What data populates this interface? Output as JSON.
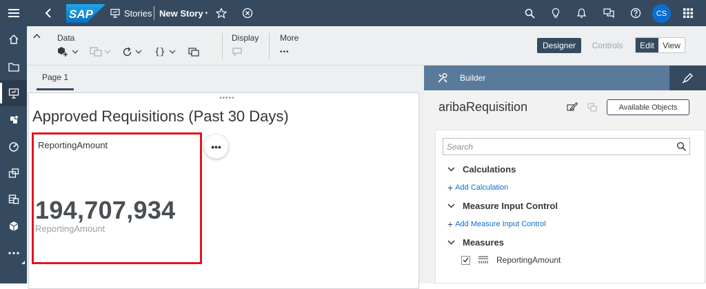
{
  "shell": {
    "logo": "SAP",
    "crumb_stories": "Stories",
    "crumb_story": "New Story",
    "dirty_marker": "•",
    "avatar_initials": "CS"
  },
  "toolbar": {
    "data_label": "Data",
    "display_label": "Display",
    "more_label": "More",
    "more_dots": "•••",
    "designer_label": "Designer",
    "controls_label": "Controls",
    "edit_label": "Edit",
    "view_label": "View"
  },
  "page_tabs": [
    {
      "label": "Page 1"
    }
  ],
  "story": {
    "title": "Approved Requisitions (Past 30 Days)",
    "grip": "•••••",
    "tile": {
      "label": "ReportingAmount",
      "value": "194,707,934",
      "sublabel": "ReportingAmount",
      "more_dots": "•••"
    }
  },
  "builder": {
    "title": "Builder",
    "model_name": "aribaRequisition",
    "available_objects_label": "Available Objects",
    "search_placeholder": "Search",
    "sections": [
      {
        "title": "Calculations",
        "add_label": "Add Calculation"
      },
      {
        "title": "Measure Input Control",
        "add_label": "Add Measure Input Control"
      },
      {
        "title": "Measures"
      }
    ],
    "measure_item": {
      "label": "ReportingAmount",
      "checked": true
    },
    "plus": "+"
  },
  "icons": {
    "menu": "menu-icon",
    "home": "home-icon",
    "files": "folder-icon",
    "stories": "presentation-icon",
    "analytic": "analytic-app-icon",
    "dashboard": "gauge-icon",
    "apps": "apps-icon",
    "data": "database-icon",
    "modeler": "cube-icon",
    "more": "more-icon"
  },
  "colors": {
    "shell": "#354a5f",
    "builder_head": "#5a7a9b",
    "highlight": "#e2141e",
    "accent": "#0a6ed1"
  }
}
